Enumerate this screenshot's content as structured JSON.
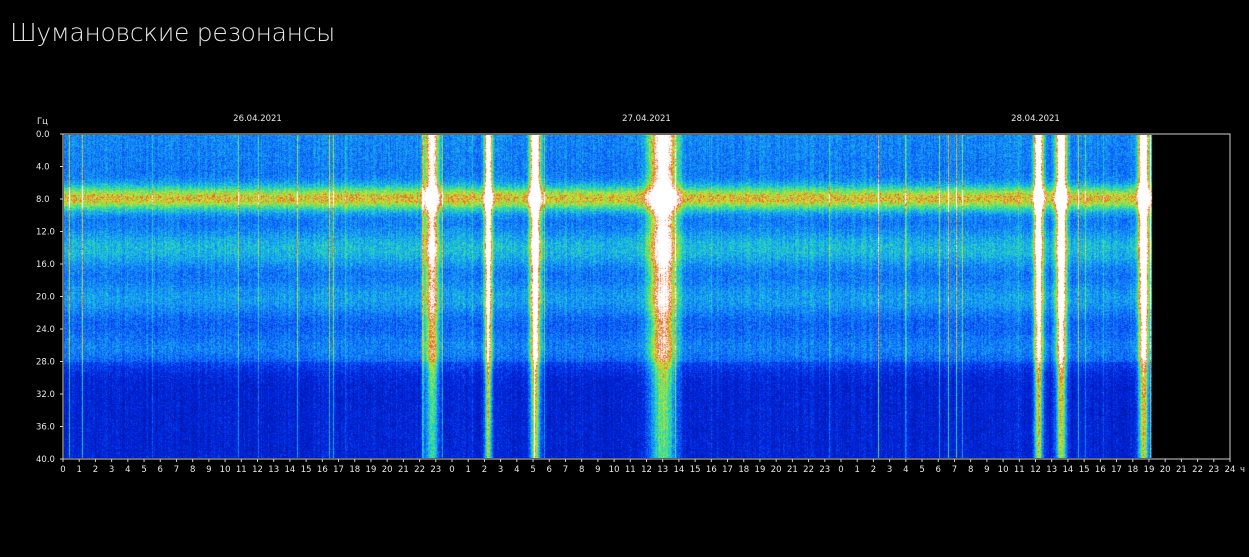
{
  "page": {
    "title": "Шумановские резонансы"
  },
  "colors": {
    "background": "#000000",
    "axis": "#d0d0d0",
    "low_intensity": "#0018c8",
    "mid_intensity": "#1ec8d2",
    "high_intensity": "#e0e020",
    "peak_intensity": "#ffffff"
  },
  "chart_data": {
    "type": "heatmap",
    "title": "",
    "ylabel": "Гц",
    "xlabel": "",
    "ylim": [
      0,
      40
    ],
    "y_inverted": true,
    "y_ticks": [
      "0.0",
      "4.0",
      "8.0",
      "12.0",
      "16.0",
      "20.0",
      "24.0",
      "28.0",
      "32.0",
      "36.0",
      "40.0"
    ],
    "x_unit": "ч",
    "x_ticks": [
      "0",
      "1",
      "2",
      "3",
      "4",
      "5",
      "6",
      "7",
      "8",
      "9",
      "10",
      "11",
      "12",
      "13",
      "14",
      "15",
      "16",
      "17",
      "18",
      "19",
      "20",
      "21",
      "22",
      "23",
      "0",
      "1",
      "2",
      "3",
      "4",
      "5",
      "6",
      "7",
      "8",
      "9",
      "10",
      "11",
      "12",
      "13",
      "14",
      "15",
      "16",
      "17",
      "18",
      "19",
      "20",
      "21",
      "22",
      "23",
      "0",
      "1",
      "2",
      "3",
      "4",
      "5",
      "6",
      "7",
      "8",
      "9",
      "10",
      "11",
      "12",
      "13",
      "14",
      "15",
      "16",
      "17",
      "18",
      "19",
      "20",
      "21",
      "22",
      "23",
      "24"
    ],
    "dates": [
      "26.04.2021",
      "27.04.2021",
      "28.04.2021"
    ],
    "x_range_hours": [
      0,
      72
    ],
    "data_end_hour": 67.2,
    "resonance_bands_hz": [
      7.8,
      14.1,
      20.3,
      26.4
    ],
    "bursts": [
      {
        "hour": 22.7,
        "width_h": 0.9,
        "intensity": 0.75
      },
      {
        "hour": 26.2,
        "width_h": 0.5,
        "intensity": 0.95
      },
      {
        "hour": 29.1,
        "width_h": 0.7,
        "intensity": 1.0
      },
      {
        "hour": 37.0,
        "width_h": 1.8,
        "intensity": 0.8
      },
      {
        "hour": 60.2,
        "width_h": 0.6,
        "intensity": 1.0
      },
      {
        "hour": 61.6,
        "width_h": 0.7,
        "intensity": 1.0
      },
      {
        "hour": 66.7,
        "width_h": 0.7,
        "intensity": 1.0
      }
    ]
  }
}
